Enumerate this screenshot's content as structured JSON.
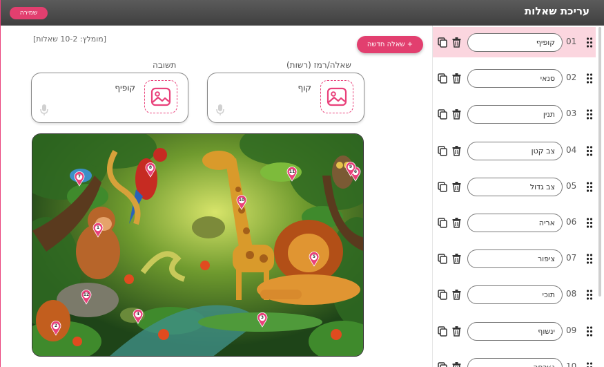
{
  "header": {
    "title": "עריכת שאלות",
    "save_label": "שמירה"
  },
  "editor": {
    "hint": "[מומלץ: 10-2 שאלות]",
    "new_question_label": "+ שאלה חדשה",
    "answer_label": "תשובה",
    "question_label": "שאלה/רמז (רשות)",
    "answer_value": "קופיף",
    "question_value": "קוף"
  },
  "questions": [
    {
      "num": "01",
      "value": "קופיף"
    },
    {
      "num": "02",
      "value": "סנאי"
    },
    {
      "num": "03",
      "value": "תנין"
    },
    {
      "num": "04",
      "value": "צב קטן"
    },
    {
      "num": "05",
      "value": "צב גדול"
    },
    {
      "num": "06",
      "value": "אריה"
    },
    {
      "num": "07",
      "value": "ציפור"
    },
    {
      "num": "08",
      "value": "תוכי"
    },
    {
      "num": "09",
      "value": "ינשוף"
    },
    {
      "num": "10",
      "value": "ג׳ירפה"
    }
  ],
  "markers": [
    "1",
    "2",
    "3",
    "4",
    "5",
    "6",
    "7",
    "8",
    "9",
    "10",
    "11",
    "12"
  ],
  "colors": {
    "accent": "#e23f6f",
    "topbar": "#4a4a4a",
    "active_row": "#fbd6df"
  }
}
